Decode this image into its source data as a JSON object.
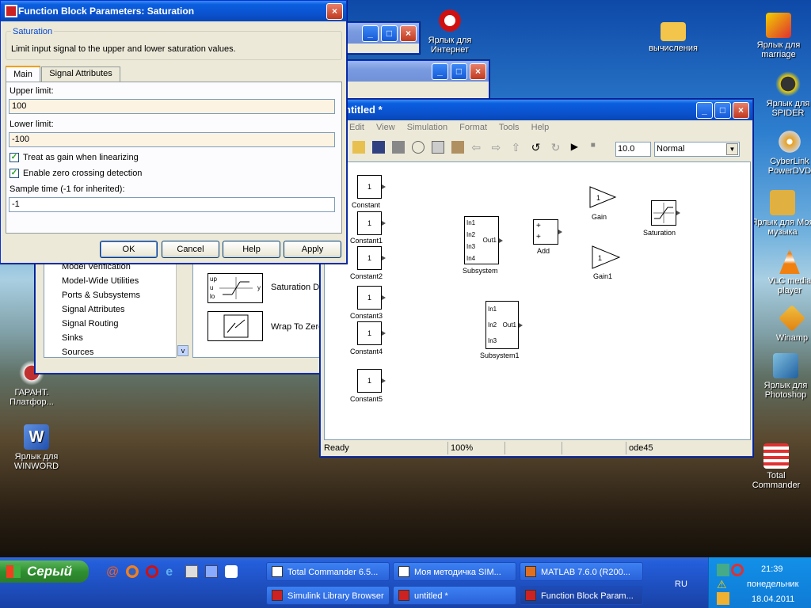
{
  "desktop": {
    "icons": [
      {
        "label": "Ярлык для Интернет",
        "icon": "opera-icon",
        "color": "#d01010"
      },
      {
        "label": "вычисления",
        "icon": "folder-icon",
        "color": "#f3c54b"
      },
      {
        "label": "Ярлык для marriage",
        "icon": "shortcut-icon",
        "color": "#e03030"
      },
      {
        "label": "Ярлык для SPIDER",
        "icon": "spider-icon",
        "color": "#333333"
      },
      {
        "label": "CyberLink PowerDVD",
        "icon": "dvd-icon",
        "color": "#e8a020"
      },
      {
        "label": "Ярлык для Моя музыка",
        "icon": "music-folder-icon",
        "color": "#e0b040"
      },
      {
        "label": "VLC media player",
        "icon": "vlc-cone-icon",
        "color": "#f08010"
      },
      {
        "label": "Winamp",
        "icon": "winamp-icon",
        "color": "#f0a020"
      },
      {
        "label": "Ярлык для Photoshop",
        "icon": "photoshop-icon",
        "color": "#4080c0"
      },
      {
        "label": "Total Commander",
        "icon": "total-commander-icon",
        "color": "#3050c0"
      },
      {
        "label": "ГАРАНТ. Платфор...",
        "icon": "garant-icon",
        "color": "#c03030"
      },
      {
        "label": "Ярлык для WINWORD",
        "icon": "word-icon",
        "color": "#2050b0"
      }
    ]
  },
  "dialog": {
    "title": "Function Block Parameters: Saturation",
    "group_title": "Saturation",
    "description": "Limit input signal to the upper and lower saturation values.",
    "tabs": [
      "Main",
      "Signal Attributes"
    ],
    "upper_label": "Upper limit:",
    "upper_value": "100",
    "lower_label": "Lower limit:",
    "lower_value": "-100",
    "check1": "Treat as gain when linearizing",
    "check2": "Enable zero crossing detection",
    "sample_label": "Sample time (-1 for inherited):",
    "sample_value": "-1",
    "buttons": {
      "ok": "OK",
      "cancel": "Cancel",
      "help": "Help",
      "apply": "Apply"
    }
  },
  "library": {
    "tree": [
      "Model Verification",
      "Model-Wide Utilities",
      "Ports & Subsystems",
      "Signal Attributes",
      "Signal Routing",
      "Sinks",
      "Sources"
    ],
    "blocks": [
      "Saturation Dy",
      "Wrap To Zero"
    ],
    "sat_ports": [
      "up",
      "u",
      "lo",
      "y"
    ]
  },
  "model": {
    "title": "ntitled *",
    "menu": [
      "Edit",
      "View",
      "Simulation",
      "Format",
      "Tools",
      "Help"
    ],
    "stop_time": "10.0",
    "mode": "Normal",
    "status": {
      "ready": "Ready",
      "zoom": "100%",
      "solver": "ode45"
    },
    "blocks": {
      "constants": [
        "Constant",
        "Constant1",
        "Constant2",
        "Constant3",
        "Constant4",
        "Constant5"
      ],
      "const_value": "1",
      "gain": "Gain",
      "gain1": "Gain1",
      "gain_value": "1",
      "saturation": "Saturation",
      "add": "Add",
      "plus": "+",
      "subsystem": "Subsystem",
      "subsystem1": "Subsystem1",
      "sub_ports": [
        "In1",
        "In2",
        "In3",
        "In4",
        "Out1"
      ],
      "sub1_ports": [
        "In1",
        "In2",
        "In3",
        "Out1"
      ]
    }
  },
  "taskbar": {
    "start": "Серый",
    "tasks_top": [
      "Total Commander 6.5...",
      "Моя методичка SIM...",
      "MATLAB 7.6.0 (R200..."
    ],
    "tasks_bottom": [
      "Simulink Library Browser",
      "untitled *",
      "Function Block Param..."
    ],
    "lang": "RU",
    "time": "21:39",
    "day": "понедельник",
    "date": "18.04.2011"
  }
}
